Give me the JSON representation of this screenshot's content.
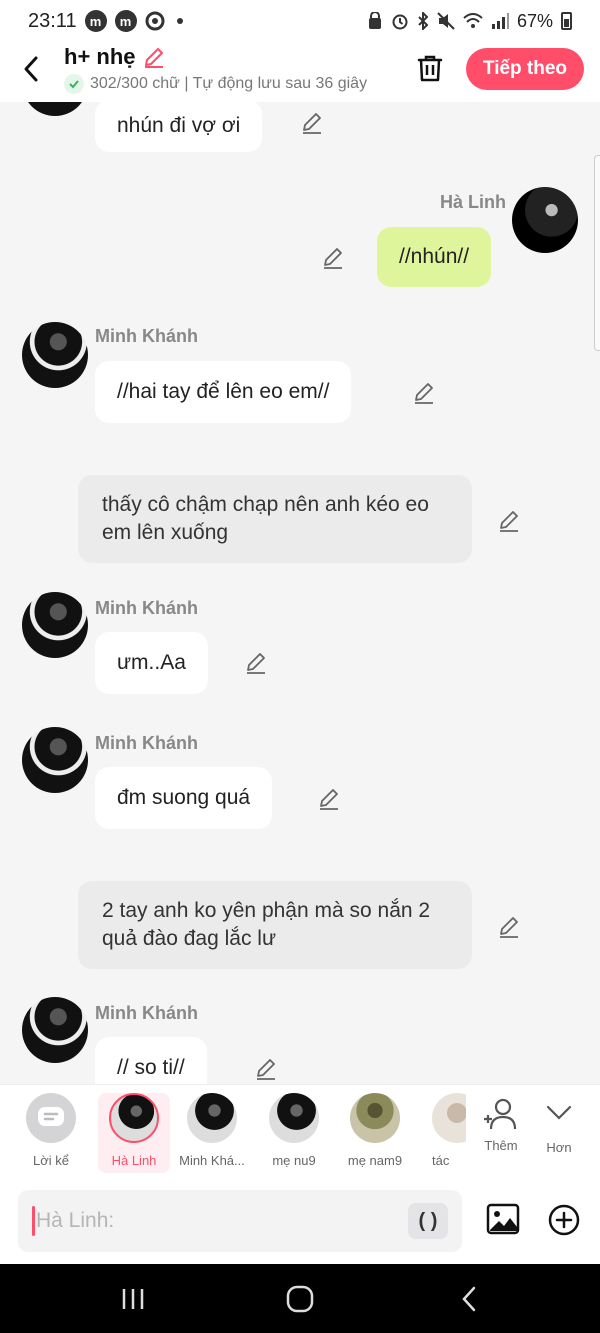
{
  "status_bar": {
    "time": "23:11",
    "battery": "67%",
    "app_icons": [
      "m",
      "m"
    ]
  },
  "header": {
    "title": "h+ nhẹ",
    "subtitle": "302/300 chữ | Tự động lưu sau 36 giây",
    "next_label": "Tiếp theo"
  },
  "messages": [
    {
      "kind": "char",
      "sender": "",
      "text": "nhún đi vợ ơi"
    },
    {
      "kind": "self",
      "sender": "Hà Linh",
      "text": "//nhún//"
    },
    {
      "kind": "char",
      "sender": "Minh Khánh",
      "text": "//hai tay để lên eo em//"
    },
    {
      "kind": "narration",
      "text": "thấy cô chậm chạp nên anh kéo eo em lên xuống"
    },
    {
      "kind": "char",
      "sender": "Minh Khánh",
      "text": "ưm..Aa"
    },
    {
      "kind": "char",
      "sender": "Minh Khánh",
      "text": "đm suong quá"
    },
    {
      "kind": "narration",
      "text": "2 tay anh ko yên phận mà so nắn 2 quả đào đag lắc lư"
    },
    {
      "kind": "char",
      "sender": "Minh Khánh",
      "text": "// so ti//"
    }
  ],
  "characters": [
    {
      "name": "Lời kể"
    },
    {
      "name": "Hà Linh"
    },
    {
      "name": "Minh Khá..."
    },
    {
      "name": "mẹ nu9"
    },
    {
      "name": "mẹ nam9"
    },
    {
      "name": "tác"
    }
  ],
  "actions": {
    "add_label": "Thêm",
    "more_label": "Hơn"
  },
  "input": {
    "placeholder": "Hà Linh:",
    "paren_label": "( )"
  },
  "colors": {
    "accent": "#ff4d6a",
    "self_bubble": "#dff59c",
    "narration_bg": "#ebebec",
    "background": "#f5f5f6"
  }
}
